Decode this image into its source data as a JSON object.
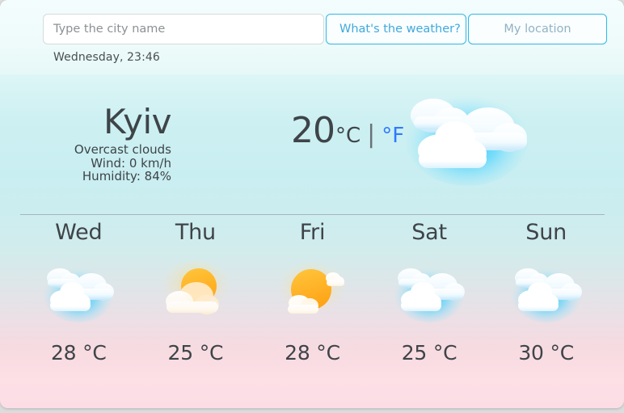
{
  "colors": {
    "accent_border": "#2cb8e8",
    "weather_button_text": "#3fa9dd",
    "location_button_text": "#8fb3c4",
    "fahrenheit_link": "#2f7bff",
    "body_text": "#3e4448",
    "divider": "#a8b5b8",
    "bg_top": "#f2fcfc",
    "bg_bottom": "#fcdde5",
    "page_bg": "#dcdcdc"
  },
  "search": {
    "placeholder": "Type the city name",
    "value": "",
    "weather_button_label": "What's the weather?",
    "location_button_label": "My location"
  },
  "datetime": "Wednesday, 23:46",
  "current": {
    "city": "Kyiv",
    "description": "Overcast clouds",
    "wind": "Wind: 0 km/h",
    "humidity": "Humidity: 84%",
    "temperature": "20",
    "unit_celsius": "°C",
    "unit_divider": "|",
    "unit_fahrenheit": "°F",
    "icon": "overcast-clouds-icon"
  },
  "forecast": [
    {
      "day": "Wed",
      "temp": "28 °C",
      "icon": "overcast-clouds-icon"
    },
    {
      "day": "Thu",
      "temp": "25 °C",
      "icon": "sun-behind-cloud-icon"
    },
    {
      "day": "Fri",
      "temp": "28 °C",
      "icon": "sun-few-clouds-icon"
    },
    {
      "day": "Sat",
      "temp": "25 °C",
      "icon": "overcast-clouds-icon"
    },
    {
      "day": "Sun",
      "temp": "30 °C",
      "icon": "overcast-clouds-icon"
    }
  ]
}
